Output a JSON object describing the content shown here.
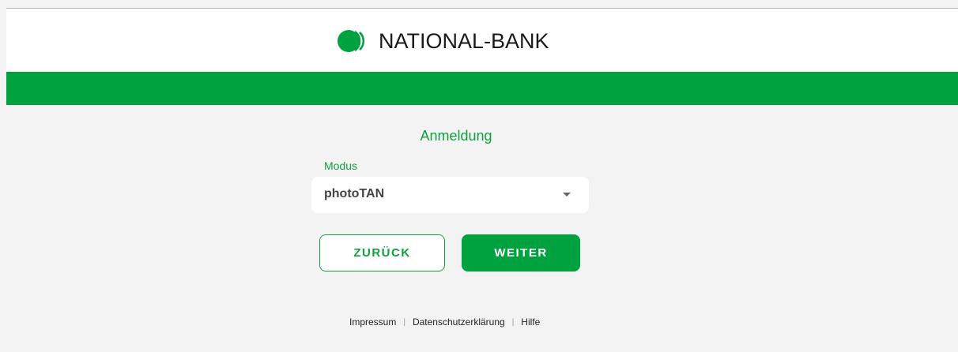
{
  "header": {
    "brand_name": "NATIONAL-BANK",
    "brand_color": "#00a13f"
  },
  "login": {
    "title": "Anmeldung",
    "mode_label": "Modus",
    "mode_value": "photoTAN",
    "dropdown_icon": "caret-down-icon"
  },
  "buttons": {
    "back": "ZURÜCK",
    "next": "WEITER"
  },
  "footer": {
    "links": [
      "Impressum",
      "Datenschutzerklärung",
      "Hilfe"
    ],
    "separator": "|"
  },
  "colors": {
    "accent": "#12a040",
    "background": "#f3f3f3",
    "header_bg": "#ffffff"
  }
}
